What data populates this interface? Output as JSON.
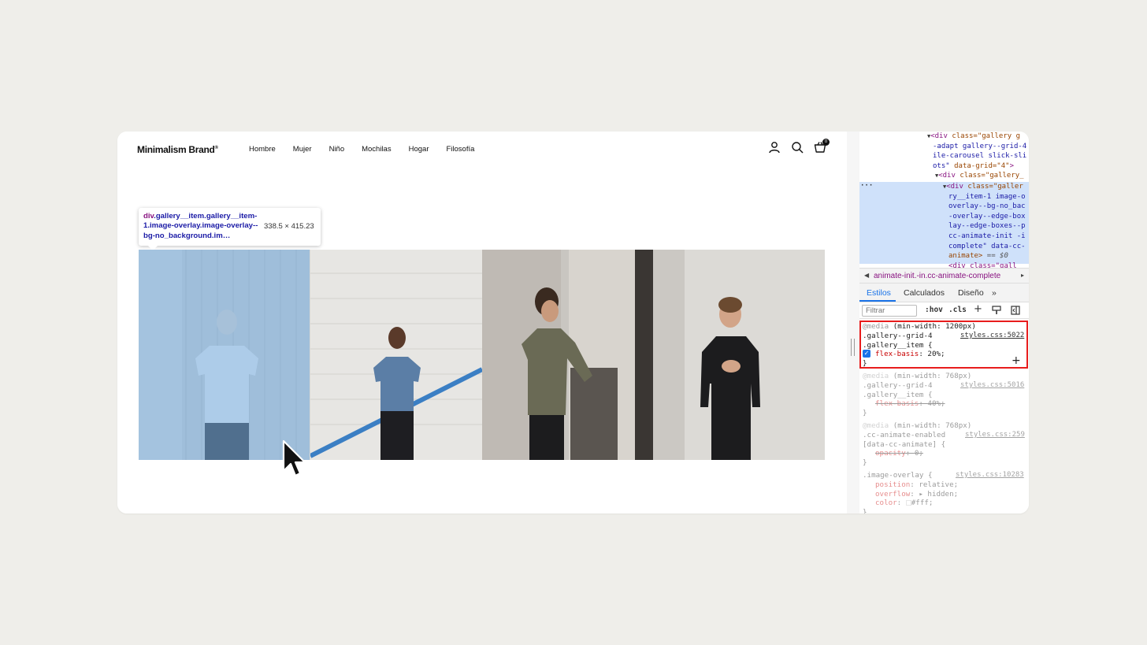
{
  "site": {
    "brand": "Minimalism Brand",
    "brand_mark": "®",
    "nav": [
      "Hombre",
      "Mujer",
      "Niño",
      "Mochilas",
      "Hogar",
      "Filosofía"
    ],
    "cart_count": "0",
    "icons": [
      "account-icon",
      "search-icon",
      "cart-icon"
    ]
  },
  "tooltip": {
    "tag": "div",
    "selector": ".gallery__item.gallery__item-1.image-overlay.image-overlay--bg-no_background.im…",
    "size": "338.5 × 415.23"
  },
  "gallery": {
    "items": [
      "gallery-item-1",
      "gallery-item-2",
      "gallery-item-3",
      "gallery-item-4"
    ],
    "highlight_color": "#6fa8dc"
  },
  "devtools": {
    "dom": {
      "line1_attrs": "class=\"gallery g",
      "line2": "-adapt gallery--grid-4",
      "line3": "ile-carousel slick-sli",
      "line4_val": "ots\"",
      "line4_attr": "data-grid=\"4\"",
      "line5_attrs": "class=\"gallery_",
      "sel1_attrs": "class=\"galler",
      "sel2": "ry__item-1 image-o",
      "sel3": "overlay--bg-no_bac",
      "sel4": "-overlay--edge-box",
      "sel5": "lay--edge-boxes--p",
      "sel6": "cc-animate-init -i",
      "sel7": "complete\" data-cc-",
      "sel8": "animate>",
      "sel8_ref": "== $0",
      "sel9": "<div class=\"gall"
    },
    "breadcrumb": "animate-init.-in.cc-animate-complete",
    "tabs": [
      "Estilos",
      "Calculados",
      "Diseño"
    ],
    "tabs_more": "»",
    "filter_placeholder": "Filtrar",
    "hov_label": ":hov",
    "cls_label": ".cls",
    "rules": {
      "r1_media": "@media",
      "r1_query": "(min-width: 1200px)",
      "r1_sel1": ".gallery--grid-4",
      "r1_src": "styles.css:5022",
      "r1_sel2": ".gallery__item {",
      "r1_prop": "flex-basis",
      "r1_value": "20%;",
      "r1_close": "}",
      "r2_media": "@media",
      "r2_query": "(min-width: 768px)",
      "r2_sel1": ".gallery--grid-4",
      "r2_src": "styles.css:5016",
      "r2_sel2": ".gallery__item {",
      "r2_prop": "flex-basis",
      "r2_value": "40%;",
      "r2_close": "}",
      "r3_media": "@media",
      "r3_query": "(min-width: 768px)",
      "r3_sel1": ".cc-animate-enabled",
      "r3_src": "styles.css:259",
      "r3_sel2": "[data-cc-animate] {",
      "r3_prop": "opacity",
      "r3_value": "0;",
      "r3_close": "}",
      "r4_sel": ".image-overlay {",
      "r4_src": "styles.css:10283",
      "r4_p1": "position",
      "r4_v1": "relative;",
      "r4_p2": "overflow",
      "r4_v2": "hidden;",
      "r4_p3": "color",
      "r4_v3": "#fff;",
      "r4_close": "}"
    }
  },
  "colors": {
    "page_bg": "#efeeea",
    "devtools_accent": "#1a73e8",
    "highlight_border": "#e81c1c"
  }
}
